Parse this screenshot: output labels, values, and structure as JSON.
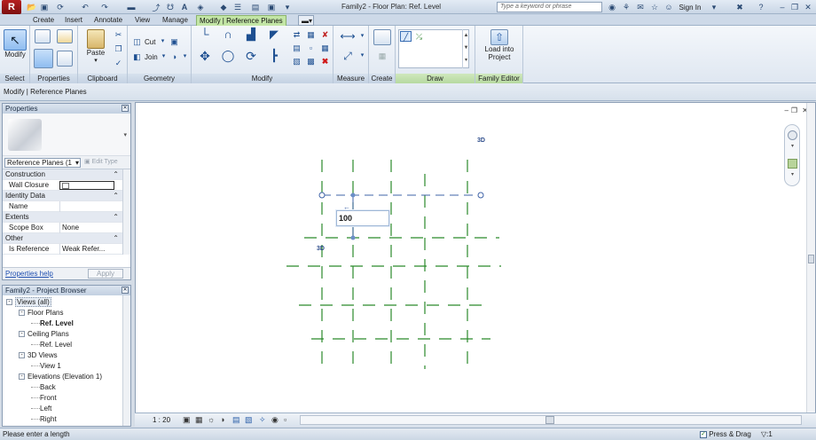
{
  "window": {
    "title": "Family2 - Floor Plan: Ref. Level",
    "app_logo": "R",
    "search_placeholder": "Type a keyword or phrase",
    "sign_in": "Sign In"
  },
  "tabs": [
    "Create",
    "Insert",
    "Annotate",
    "View",
    "Manage",
    "Modify | Reference Planes"
  ],
  "active_tab": 5,
  "ribbon": {
    "groups": [
      {
        "label": "Select"
      },
      {
        "label": "Properties"
      },
      {
        "label": "Clipboard"
      },
      {
        "label": "Geometry"
      },
      {
        "label": "Modify"
      },
      {
        "label": "Measure"
      },
      {
        "label": "Create"
      },
      {
        "label": "Draw"
      },
      {
        "label": "Family Editor"
      }
    ],
    "modify_btn": "Modify",
    "paste_btn": "Paste",
    "cut_btn": "Cut",
    "join_btn": "Join",
    "load_btn_line1": "Load into",
    "load_btn_line2": "Project"
  },
  "options_bar": "Modify | Reference Planes",
  "properties": {
    "title": "Properties",
    "type_selector": "Reference Planes (1",
    "edit_type": "Edit Type",
    "rows": [
      {
        "section": "Construction"
      },
      {
        "key": "Wall Closure",
        "value": ""
      },
      {
        "section": "Identity Data"
      },
      {
        "key": "Name",
        "value": ""
      },
      {
        "section": "Extents"
      },
      {
        "key": "Scope Box",
        "value": "None"
      },
      {
        "section": "Other"
      },
      {
        "key": "Is Reference",
        "value": "Weak Refer..."
      }
    ],
    "help_link": "Properties help",
    "apply_btn": "Apply"
  },
  "browser": {
    "title": "Family2 - Project Browser",
    "nodes": [
      {
        "label": "Views (all)",
        "level": 0,
        "toggle": "-"
      },
      {
        "label": "Floor Plans",
        "level": 1,
        "toggle": "-"
      },
      {
        "label": "Ref. Level",
        "level": 2,
        "toggle": "",
        "bold": true
      },
      {
        "label": "Ceiling Plans",
        "level": 1,
        "toggle": "-"
      },
      {
        "label": "Ref. Level",
        "level": 2,
        "toggle": ""
      },
      {
        "label": "3D Views",
        "level": 1,
        "toggle": "-"
      },
      {
        "label": "View 1",
        "level": 2,
        "toggle": ""
      },
      {
        "label": "Elevations (Elevation 1)",
        "level": 1,
        "toggle": "-"
      },
      {
        "label": "Back",
        "level": 2,
        "toggle": ""
      },
      {
        "label": "Front",
        "level": 2,
        "toggle": ""
      },
      {
        "label": "Left",
        "level": 2,
        "toggle": ""
      },
      {
        "label": "Right",
        "level": 2,
        "toggle": ""
      }
    ]
  },
  "canvas": {
    "dimension_value": "100",
    "tag_3d_a": "3D",
    "tag_3d_b": "3D",
    "ref_plane_color": "#2b8a2b",
    "selected_plane_color": "#3f63a7"
  },
  "view_control": {
    "scale": "1 : 20"
  },
  "status": {
    "message": "Please enter a length",
    "press_drag": "Press & Drag",
    "filter_count": ":1"
  }
}
